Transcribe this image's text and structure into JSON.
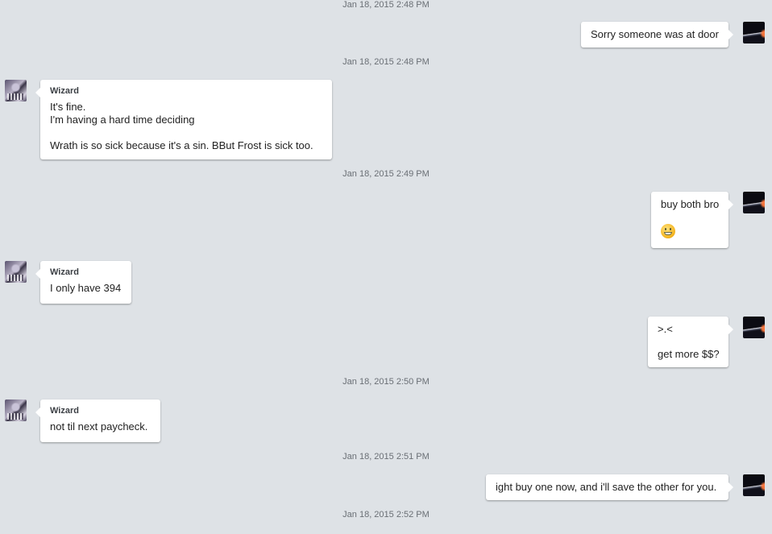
{
  "timestamps": [
    "Jan 18, 2015 2:48 PM",
    "Jan 18, 2015 2:48 PM",
    "Jan 18, 2015 2:49 PM",
    "Jan 18, 2015 2:50 PM",
    "Jan 18, 2015 2:51 PM",
    "Jan 18, 2015 2:52 PM"
  ],
  "messages": [
    {
      "side": "right",
      "lines": [
        "Sorry someone was at door"
      ]
    },
    {
      "side": "left",
      "sender": "Wizard",
      "lines": [
        "It's fine.",
        "I'm having a hard time deciding",
        "",
        "Wrath is so sick because it's a sin. BBut Frost is sick too."
      ]
    },
    {
      "side": "right",
      "lines": [
        "buy both bro"
      ],
      "emoji": "grinning-face-emoji"
    },
    {
      "side": "left",
      "sender": "Wizard",
      "lines": [
        "I only have 394"
      ]
    },
    {
      "side": "right",
      "lines": [
        ">.<",
        "",
        "get more $$?"
      ]
    },
    {
      "side": "left",
      "sender": "Wizard",
      "lines": [
        "not til next paycheck."
      ]
    },
    {
      "side": "right",
      "lines": [
        "ight buy one now, and i'll save the other for you."
      ]
    }
  ],
  "avatars": {
    "me": "space-planet-avatar",
    "wizard": "wizard-avatar"
  },
  "colors": {
    "background": "#dee2e6",
    "bubble": "#ffffff",
    "timestamp": "#6a6f75"
  }
}
